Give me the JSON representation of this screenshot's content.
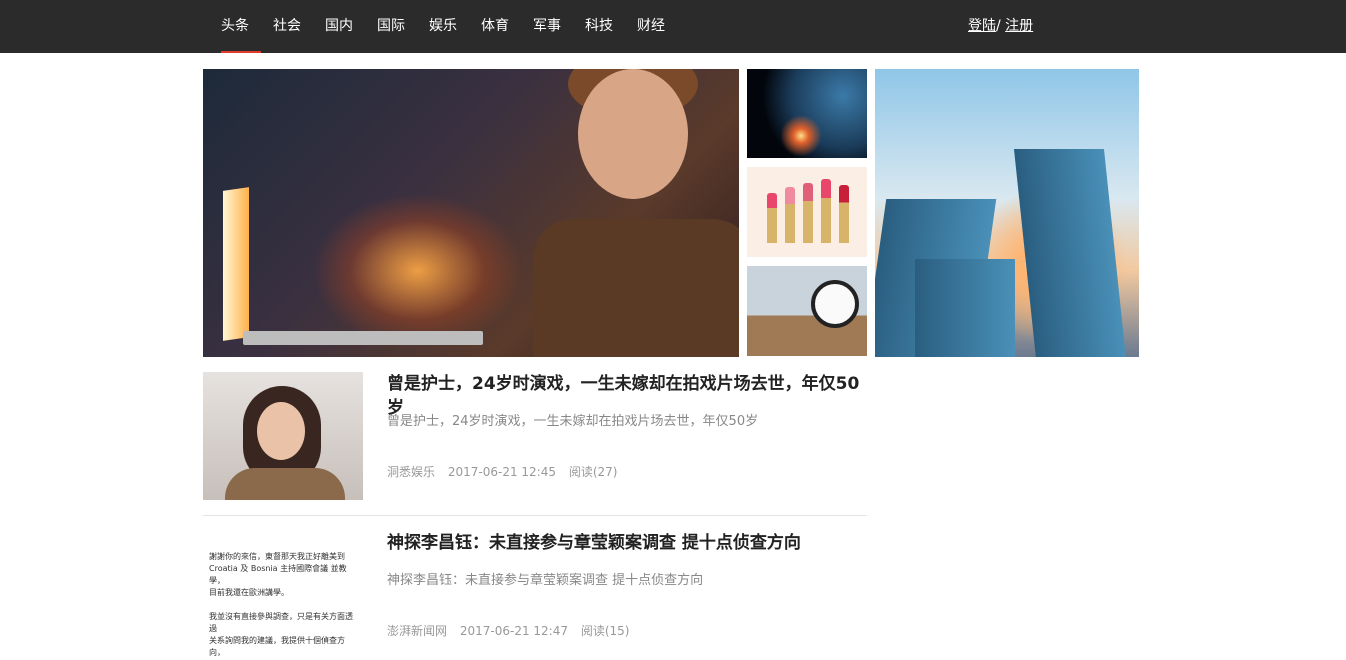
{
  "nav": {
    "items": [
      "头条",
      "社会",
      "国内",
      "国际",
      "娱乐",
      "体育",
      "军事",
      "科技",
      "财经"
    ],
    "active_index": 0
  },
  "auth": {
    "login": "登陆",
    "separator": "/",
    "register": "注册"
  },
  "colors": {
    "topbar": "#2b2b2b",
    "active_underline": "#e23a2e"
  },
  "articles": [
    {
      "title": "曾是护士，24岁时演戏，一生未嫁却在拍戏片场去世，年仅50岁",
      "summary": "曾是护士，24岁时演戏，一生未嫁却在拍戏片场去世，年仅50岁",
      "source": "洞悉娱乐",
      "time": "2017-06-21 12:45",
      "reads": "阅读(27)"
    },
    {
      "title": "神探李昌钰：未直接参与章莹颖案调查 提十点侦查方向",
      "summary": "神探李昌钰：未直接参与章莹颖案调查 提十点侦查方向",
      "source": "澎湃新闻网",
      "time": "2017-06-21 12:47",
      "reads": "阅读(15)",
      "thumb_text": "謝謝你的來信，東督那天我正好離美到\nCroatia 及 Bosnia 主持國際會議 並教學，\n目前我還在歐洲講學。\n\n我並沒有直接參與調查，只是有关方面透過\n关系詢問我的建議，我提供十個偵查方向，\n包括追查車輛，強化錄影畫面，清查強姦累\n犯檔案，收集加油站錄影帶，提供獎金報\n息，公路收費站紀錄及影片分析。車型車号"
    }
  ]
}
